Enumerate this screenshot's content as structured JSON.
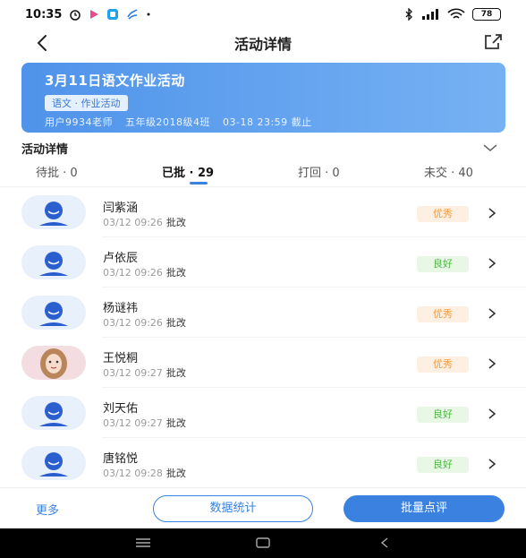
{
  "status_bar": {
    "time": "10:35",
    "battery": "78"
  },
  "header": {
    "title": "活动详情"
  },
  "activity": {
    "title": "3月11日语文作业活动",
    "tag": "语文 · 作业活动",
    "teacher": "用户9934老师",
    "class_name": "五年级2018级4班",
    "deadline": "03-18 23:59 截止"
  },
  "section": {
    "title": "活动详情"
  },
  "tabs": [
    {
      "label": "待批 · 0"
    },
    {
      "label": "已批 · 29"
    },
    {
      "label": "打回 · 0"
    },
    {
      "label": "未交 · 40"
    }
  ],
  "students": [
    {
      "name": "闫紫涵",
      "time": "03/12 09:26",
      "action": "批改",
      "grade": "优秀"
    },
    {
      "name": "卢依辰",
      "time": "03/12 09:26",
      "action": "批改",
      "grade": "良好"
    },
    {
      "name": "杨谜祎",
      "time": "03/12 09:26",
      "action": "批改",
      "grade": "优秀"
    },
    {
      "name": "王悦桐",
      "time": "03/12 09:27",
      "action": "批改",
      "grade": "优秀"
    },
    {
      "name": "刘天佑",
      "time": "03/12 09:27",
      "action": "批改",
      "grade": "良好"
    },
    {
      "name": "唐铭悦",
      "time": "03/12 09:28",
      "action": "批改",
      "grade": "良好"
    }
  ],
  "bottom": {
    "more_label": "更多",
    "stats_label": "数据统计",
    "review_label": "批量点评"
  },
  "colors": {
    "accent": "#3b82e0",
    "excellent": "#f09a3a",
    "good": "#4cb844"
  }
}
